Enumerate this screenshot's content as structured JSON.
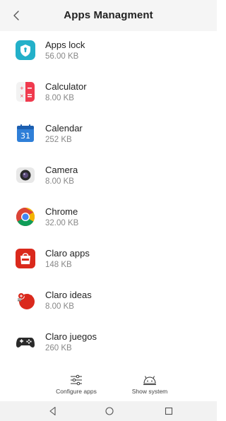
{
  "header": {
    "title": "Apps Managment",
    "back_icon": "chevron-left-icon"
  },
  "apps": [
    {
      "name": "Apps lock",
      "size": "56.00 KB",
      "icon": "apps-lock-icon"
    },
    {
      "name": "Calculator",
      "size": "8.00 KB",
      "icon": "calculator-icon"
    },
    {
      "name": "Calendar",
      "size": "252 KB",
      "icon": "calendar-icon",
      "icon_text": "31"
    },
    {
      "name": "Camera",
      "size": "8.00 KB",
      "icon": "camera-icon"
    },
    {
      "name": "Chrome",
      "size": "32.00 KB",
      "icon": "chrome-icon"
    },
    {
      "name": "Claro apps",
      "size": "148 KB",
      "icon": "claro-apps-icon"
    },
    {
      "name": "Claro ideas",
      "size": "8.00 KB",
      "icon": "claro-ideas-icon"
    },
    {
      "name": "Claro juegos",
      "size": "260 KB",
      "icon": "claro-juegos-icon"
    }
  ],
  "bottom_actions": {
    "configure_label": "Configure apps",
    "configure_icon": "sliders-icon",
    "system_label": "Show system",
    "system_icon": "android-icon"
  },
  "nav": {
    "back_icon": "triangle-back-icon",
    "home_icon": "circle-home-icon",
    "recent_icon": "square-recent-icon"
  },
  "colors": {
    "header_bg": "#f5f5f5",
    "nav_bg": "#f2f2f2",
    "text_primary": "#222222",
    "text_secondary": "#888888",
    "claro_red": "#da291c",
    "apps_lock_teal": "#23b0c9",
    "calendar_blue": "#2f7fd8"
  }
}
